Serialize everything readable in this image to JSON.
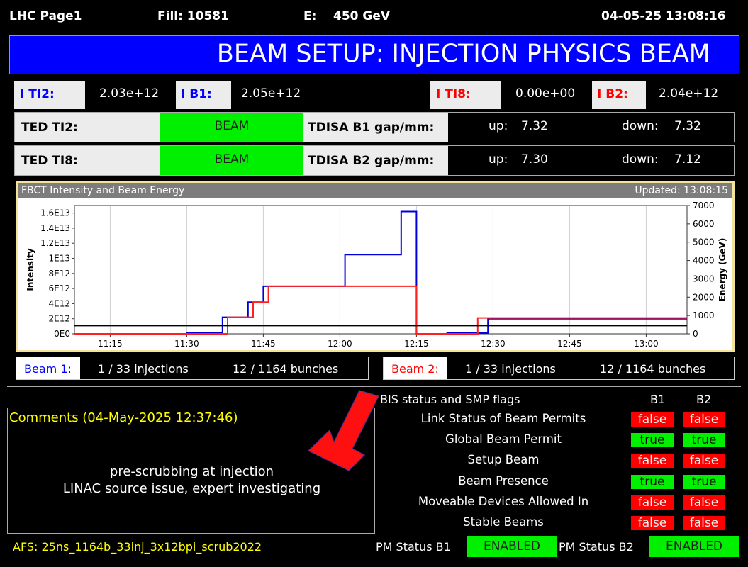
{
  "header": {
    "page": "LHC Page1",
    "fill": "Fill: 10581",
    "energy_label": "E:",
    "energy_value": "450 GeV",
    "datetime": "04-05-25 13:08:16"
  },
  "banner": {
    "title": "BEAM SETUP: INJECTION PHYSICS BEAM",
    "color": "#0000ff"
  },
  "intensities": [
    {
      "label": "I TI2:",
      "value": "2.03e+12",
      "color": "#0000ff"
    },
    {
      "label": "I B1:",
      "value": "2.05e+12",
      "color": "#0000ff"
    },
    {
      "label": "I TI8:",
      "value": "0.00e+00",
      "color": "#ff0000"
    },
    {
      "label": "I B2:",
      "value": "2.04e+12",
      "color": "#ff0000"
    }
  ],
  "ted": [
    {
      "label": "TED TI2:",
      "status": "BEAM",
      "tdisa_label": "TDISA B1 gap/mm:",
      "up_label": "up:",
      "up": "7.32",
      "down_label": "down:",
      "down": "7.32"
    },
    {
      "label": "TED TI8:",
      "status": "BEAM",
      "tdisa_label": "TDISA B2 gap/mm:",
      "up_label": "up:",
      "up": "7.30",
      "down_label": "down:",
      "down": "7.12"
    }
  ],
  "chart_panel": {
    "title": "FBCT Intensity and Beam Energy",
    "updated": "Updated: 13:08:15"
  },
  "chart_data": {
    "type": "line",
    "ylabel": "Intensity",
    "y2label": "Energy (GeV)",
    "ylim": [
      0,
      17000000000000.0
    ],
    "y2lim": [
      0,
      7000
    ],
    "yticks": [
      0,
      2000000000000.0,
      4000000000000.0,
      6000000000000.0,
      8000000000000.0,
      10000000000000.0,
      12000000000000.0,
      14000000000000.0,
      16000000000000.0
    ],
    "ytick_labels": [
      "0E0",
      "2E12",
      "4E12",
      "6E12",
      "8E12",
      "1E13",
      "1.2E13",
      "1.4E13",
      "1.6E13"
    ],
    "y2ticks": [
      0,
      1000,
      2000,
      3000,
      4000,
      5000,
      6000,
      7000
    ],
    "y2tick_labels": [
      "0",
      "1000",
      "2000",
      "3000",
      "4000",
      "5000",
      "6000",
      "7000"
    ],
    "xlim": [
      "11:08",
      "13:08"
    ],
    "xticks": [
      "11:15",
      "11:30",
      "11:45",
      "12:00",
      "12:15",
      "12:30",
      "12:45",
      "13:00"
    ],
    "series": [
      {
        "axis": "left",
        "color": "#0000dd",
        "points": [
          [
            "11:08",
            0
          ],
          [
            "11:30",
            0
          ],
          [
            "11:30",
            150000000000.0
          ],
          [
            "11:37",
            150000000000.0
          ],
          [
            "11:37",
            2200000000000.0
          ],
          [
            "11:42",
            2200000000000.0
          ],
          [
            "11:42",
            4200000000000.0
          ],
          [
            "11:45",
            4200000000000.0
          ],
          [
            "11:45",
            6300000000000.0
          ],
          [
            "12:01",
            6300000000000.0
          ],
          [
            "12:01",
            8800000000000.0
          ],
          [
            "12:01",
            10500000000000.0
          ],
          [
            "12:12",
            10500000000000.0
          ],
          [
            "12:12",
            16200000000000.0
          ],
          [
            "12:15",
            16200000000000.0
          ],
          [
            "12:15",
            0
          ],
          [
            "12:21",
            0
          ],
          [
            "12:21",
            100000000000.0
          ],
          [
            "12:29",
            100000000000.0
          ],
          [
            "12:29",
            2000000000000.0
          ],
          [
            "13:08",
            2000000000000.0
          ]
        ]
      },
      {
        "axis": "left",
        "color": "#ff2020",
        "points": [
          [
            "11:08",
            0
          ],
          [
            "11:38",
            0
          ],
          [
            "11:38",
            2200000000000.0
          ],
          [
            "11:43",
            2200000000000.0
          ],
          [
            "11:43",
            4200000000000.0
          ],
          [
            "11:46",
            4200000000000.0
          ],
          [
            "11:46",
            6300000000000.0
          ],
          [
            "12:15",
            6300000000000.0
          ],
          [
            "12:15",
            0
          ],
          [
            "12:27",
            0
          ],
          [
            "12:27",
            2100000000000.0
          ],
          [
            "13:08",
            2100000000000.0
          ]
        ]
      },
      {
        "axis": "right",
        "color": "#000000",
        "points": [
          [
            "11:08",
            450
          ],
          [
            "13:08",
            450
          ]
        ]
      }
    ]
  },
  "beams": [
    {
      "label": "Beam 1:",
      "injections": "1 / 33 injections",
      "bunches": "12 / 1164 bunches",
      "color": "#0000ff"
    },
    {
      "label": "Beam 2:",
      "injections": "1 / 33 injections",
      "bunches": "12 / 1164 bunches",
      "color": "#ff0000"
    }
  ],
  "comments": {
    "title": "Comments (04-May-2025 12:37:46)",
    "line1": "pre-scrubbing at injection",
    "line2": "LINAC source issue, expert investigating"
  },
  "bis": {
    "title": "BIS status and SMP flags",
    "col1": "B1",
    "col2": "B2",
    "rows": [
      {
        "label": "Link Status of Beam Permits",
        "b1": "false",
        "b2": "false"
      },
      {
        "label": "Global Beam Permit",
        "b1": "true",
        "b2": "true"
      },
      {
        "label": "Setup Beam",
        "b1": "false",
        "b2": "false"
      },
      {
        "label": "Beam Presence",
        "b1": "true",
        "b2": "true"
      },
      {
        "label": "Moveable Devices Allowed In",
        "b1": "false",
        "b2": "false"
      },
      {
        "label": "Stable Beams",
        "b1": "false",
        "b2": "false"
      }
    ]
  },
  "footer": {
    "afs": "AFS: 25ns_1164b_33inj_3x12bpi_scrub2022",
    "pm1_label": "PM Status B1",
    "pm1": "ENABLED",
    "pm2_label": "PM Status B2",
    "pm2": "ENABLED"
  }
}
